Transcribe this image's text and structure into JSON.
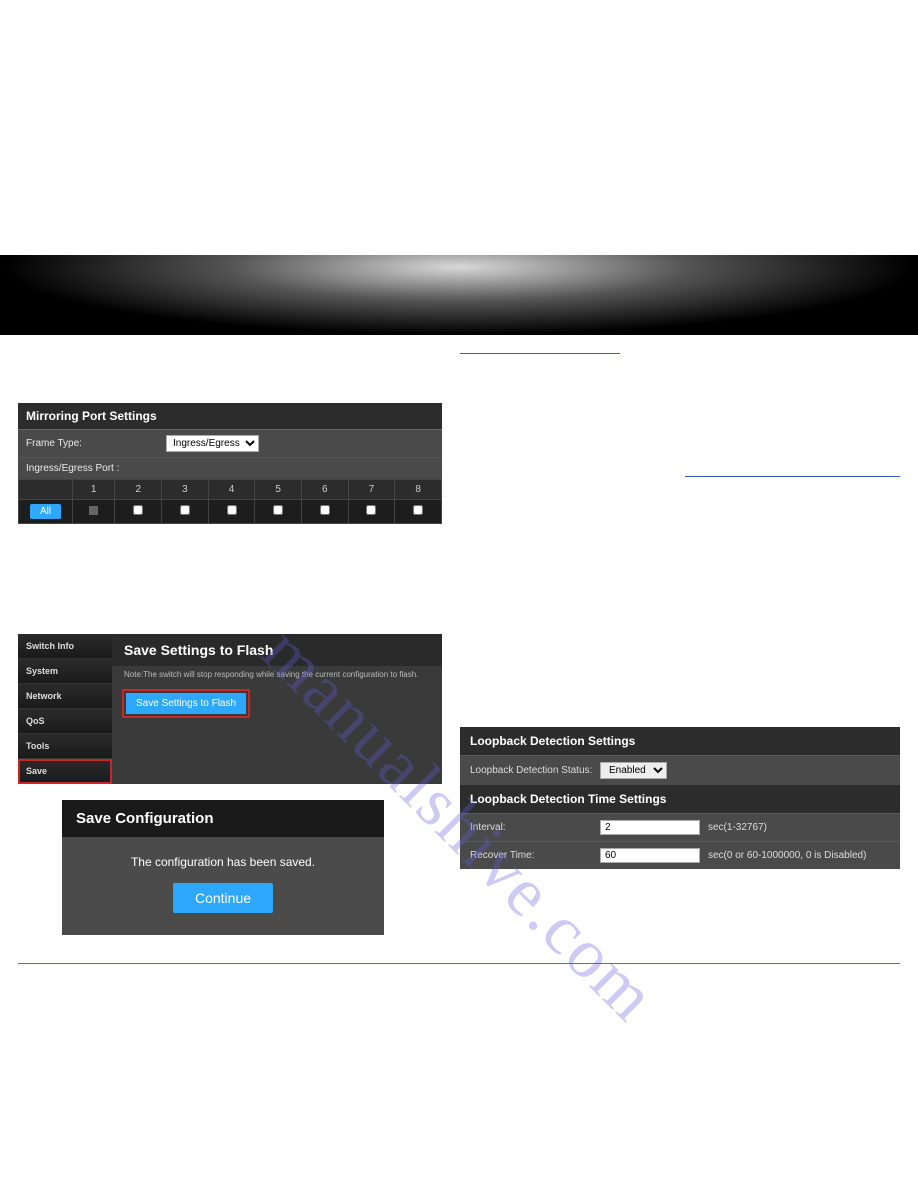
{
  "mirroring": {
    "title": "Mirroring Port Settings",
    "frame_type_label": "Frame Type:",
    "frame_type_value": "Ingress/Egress",
    "subhead": "Ingress/Egress Port :",
    "ports": [
      "1",
      "2",
      "3",
      "4",
      "5",
      "6",
      "7",
      "8"
    ],
    "all_btn": "All"
  },
  "side_nav": [
    "Switch Info",
    "System",
    "Network",
    "QoS",
    "Tools",
    "Save"
  ],
  "save_flash": {
    "title": "Save Settings to Flash",
    "note": "Note:The switch will stop responding while saving the current configuration to flash.",
    "button": "Save Settings to Flash"
  },
  "save_conf": {
    "title": "Save Configuration",
    "msg": "The configuration has been saved.",
    "continue": "Continue"
  },
  "loopback": {
    "title1": "Loopback Detection Settings",
    "status_label": "Loopback Detection Status:",
    "status_value": "Enabled",
    "title2": "Loopback Detection Time Settings",
    "interval_label": "Interval:",
    "interval_value": "2",
    "interval_hint": "sec(1-32767)",
    "recover_label": "Recover Time:",
    "recover_value": "60",
    "recover_hint": "sec(0 or 60-1000000, 0 is Disabled)"
  }
}
